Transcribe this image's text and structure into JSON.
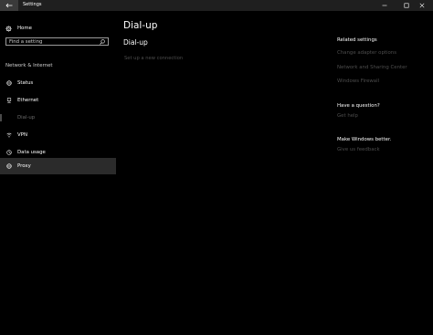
{
  "window": {
    "title": "Settings"
  },
  "sidebar": {
    "home_label": "Home",
    "search_placeholder": "Find a setting",
    "section_label": "Network & Internet",
    "items": [
      {
        "label": "Status",
        "icon": "globe-icon"
      },
      {
        "label": "Ethernet",
        "icon": "ethernet-icon"
      },
      {
        "label": "Dial-up",
        "icon": "dial-up-icon",
        "selected": true
      },
      {
        "label": "VPN",
        "icon": "vpn-icon"
      },
      {
        "label": "Data usage",
        "icon": "data-usage-icon"
      },
      {
        "label": "Proxy",
        "icon": "proxy-globe-icon",
        "hovered": true
      }
    ]
  },
  "main": {
    "page_title": "Dial-up",
    "section_heading": "Dial-up",
    "setup_link": "Set up a new connection"
  },
  "related": {
    "heading": "Related settings",
    "links": [
      "Change adapter options",
      "Network and Sharing Center",
      "Windows Firewall"
    ]
  },
  "question": {
    "heading": "Have a question?",
    "link": "Get help"
  },
  "feedback": {
    "heading": "Make Windows better.",
    "link": "Give us feedback"
  },
  "colors": {
    "background": "#000000",
    "titlebar": "#1f1f1f",
    "hover": "#2b2b2b",
    "disabled_link": "#4d4d4d"
  }
}
